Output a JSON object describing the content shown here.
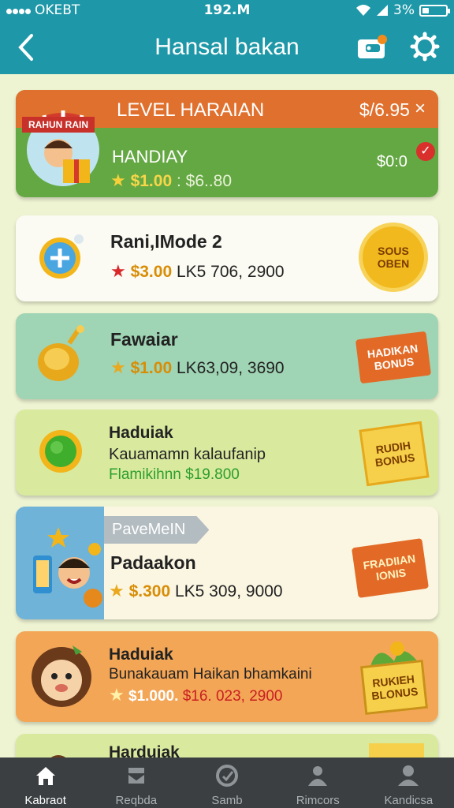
{
  "status": {
    "carrier": "OKEBT",
    "time": "192.M",
    "battery": "3%",
    "battery_level": 0.3
  },
  "header": {
    "title": "Hansal bakan"
  },
  "featured": {
    "ribbon": "RAHUN RAIN",
    "level_label": "LEVEL HARAIAN",
    "level_price": "$/6.95",
    "name": "HANDIAY",
    "price": "$1.00",
    "extra": ": $6..80",
    "amount": "$0:0"
  },
  "cards": [
    {
      "name": "Rani,IMode 2",
      "price": "$3.00",
      "detail": "LK5 706, 2900",
      "badge": "SOUS\nOBEN"
    },
    {
      "name": "Fawaiar",
      "price": "$1.00",
      "detail": "LK63,09, 3690",
      "badge": "HADIKAN\nBONUS"
    },
    {
      "name": "Haduiak",
      "subtitle": "Kauamamn kalaufanip",
      "promo": "Flamikihnn $19.800",
      "badge": "RUDIH\nBONUS"
    },
    {
      "tag": "PaveMeIN",
      "name": "Padaakon",
      "price": "$.300",
      "detail": "LK5 309, 9000",
      "badge": "FRADIIAN\nIONIS"
    },
    {
      "name": "Haduiak",
      "subtitle": "Bunakauam Haikan bhamkaini",
      "price": "$1.000.",
      "detail": "$16. 023, 2900",
      "badge": "RUKIEH\nBLONUS"
    },
    {
      "name": "Harduiak"
    }
  ],
  "nav": [
    {
      "label": "Kabraot",
      "icon": "home-icon"
    },
    {
      "label": "Reqbda",
      "icon": "store-icon"
    },
    {
      "label": "Samb",
      "icon": "refresh-icon"
    },
    {
      "label": "Rimcors",
      "icon": "people-icon"
    },
    {
      "label": "Kandicsa",
      "icon": "person-icon"
    }
  ],
  "colors": {
    "header": "#1e98a8",
    "background": "#eef3d2",
    "orange": "#e0702e",
    "green": "#64a843",
    "gold": "#e9b21b",
    "nav": "#3b3f42"
  }
}
